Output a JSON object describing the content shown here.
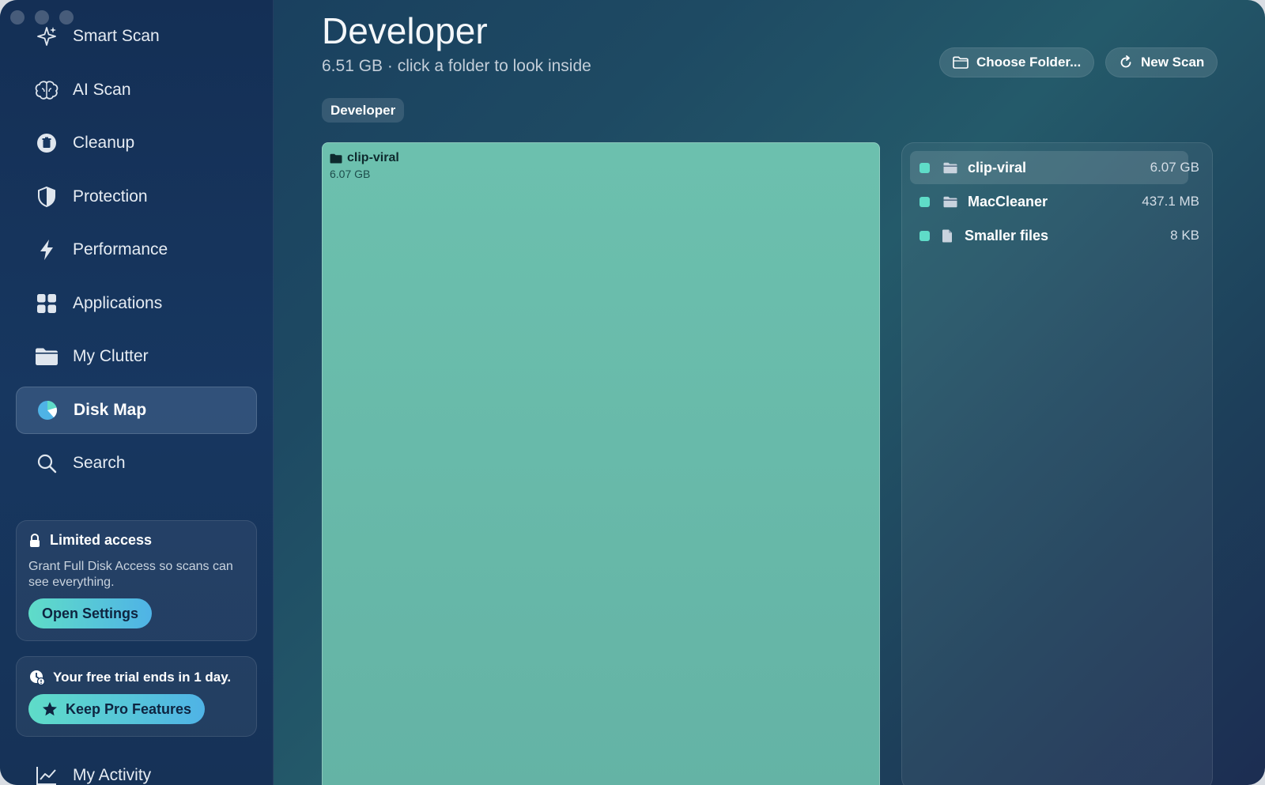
{
  "sidebar": {
    "items": [
      {
        "label": "Smart Scan",
        "icon": "sparkles-icon"
      },
      {
        "label": "AI Scan",
        "icon": "brain-icon"
      },
      {
        "label": "Cleanup",
        "icon": "trash-icon"
      },
      {
        "label": "Protection",
        "icon": "shield-icon"
      },
      {
        "label": "Performance",
        "icon": "bolt-icon"
      },
      {
        "label": "Applications",
        "icon": "grid-icon"
      },
      {
        "label": "My Clutter",
        "icon": "folder-icon"
      },
      {
        "label": "Disk Map",
        "icon": "pie-chart-icon",
        "active": true
      },
      {
        "label": "Search",
        "icon": "search-icon"
      },
      {
        "label": "My Activity",
        "icon": "activity-chart-icon"
      }
    ],
    "limited_access": {
      "title": "Limited access",
      "text": "Grant Full Disk Access so scans can see everything.",
      "button": "Open Settings"
    },
    "trial": {
      "text": "Your free trial ends in 1 day.",
      "button": "Keep Pro Features"
    }
  },
  "main": {
    "title": "Developer",
    "subtitle": "6.51 GB · click a folder to look inside",
    "choose_folder_label": "Choose Folder...",
    "new_scan_label": "New Scan",
    "breadcrumb": "Developer",
    "treemap": {
      "name": "clip-viral",
      "size": "6.07 GB",
      "color": "#6cc0ae"
    },
    "list": [
      {
        "name": "clip-viral",
        "size": "6.07 GB",
        "type": "folder"
      },
      {
        "name": "MacCleaner",
        "size": "437.1 MB",
        "type": "folder"
      },
      {
        "name": "Smaller files",
        "size": "8 KB",
        "type": "file"
      }
    ]
  },
  "colors": {
    "accent": "#5fdcc8",
    "accent2": "#4fb3e6"
  }
}
